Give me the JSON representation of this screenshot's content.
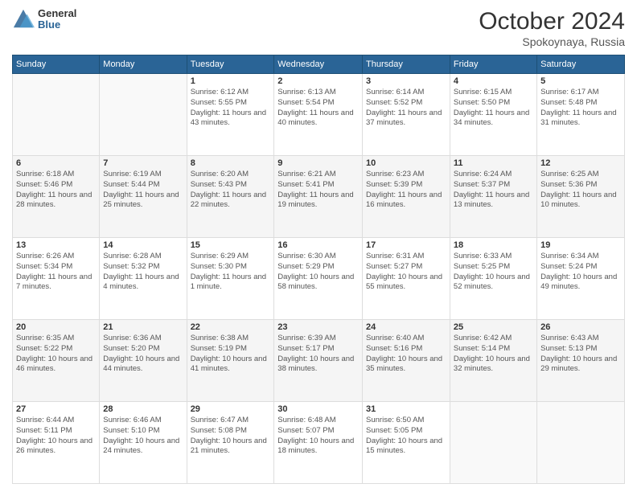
{
  "header": {
    "logo_general": "General",
    "logo_blue": "Blue",
    "month_title": "October 2024",
    "location": "Spokoynaya, Russia"
  },
  "days_of_week": [
    "Sunday",
    "Monday",
    "Tuesday",
    "Wednesday",
    "Thursday",
    "Friday",
    "Saturday"
  ],
  "weeks": [
    [
      {
        "day": "",
        "info": ""
      },
      {
        "day": "",
        "info": ""
      },
      {
        "day": "1",
        "info": "Sunrise: 6:12 AM\nSunset: 5:55 PM\nDaylight: 11 hours and 43 minutes."
      },
      {
        "day": "2",
        "info": "Sunrise: 6:13 AM\nSunset: 5:54 PM\nDaylight: 11 hours and 40 minutes."
      },
      {
        "day": "3",
        "info": "Sunrise: 6:14 AM\nSunset: 5:52 PM\nDaylight: 11 hours and 37 minutes."
      },
      {
        "day": "4",
        "info": "Sunrise: 6:15 AM\nSunset: 5:50 PM\nDaylight: 11 hours and 34 minutes."
      },
      {
        "day": "5",
        "info": "Sunrise: 6:17 AM\nSunset: 5:48 PM\nDaylight: 11 hours and 31 minutes."
      }
    ],
    [
      {
        "day": "6",
        "info": "Sunrise: 6:18 AM\nSunset: 5:46 PM\nDaylight: 11 hours and 28 minutes."
      },
      {
        "day": "7",
        "info": "Sunrise: 6:19 AM\nSunset: 5:44 PM\nDaylight: 11 hours and 25 minutes."
      },
      {
        "day": "8",
        "info": "Sunrise: 6:20 AM\nSunset: 5:43 PM\nDaylight: 11 hours and 22 minutes."
      },
      {
        "day": "9",
        "info": "Sunrise: 6:21 AM\nSunset: 5:41 PM\nDaylight: 11 hours and 19 minutes."
      },
      {
        "day": "10",
        "info": "Sunrise: 6:23 AM\nSunset: 5:39 PM\nDaylight: 11 hours and 16 minutes."
      },
      {
        "day": "11",
        "info": "Sunrise: 6:24 AM\nSunset: 5:37 PM\nDaylight: 11 hours and 13 minutes."
      },
      {
        "day": "12",
        "info": "Sunrise: 6:25 AM\nSunset: 5:36 PM\nDaylight: 11 hours and 10 minutes."
      }
    ],
    [
      {
        "day": "13",
        "info": "Sunrise: 6:26 AM\nSunset: 5:34 PM\nDaylight: 11 hours and 7 minutes."
      },
      {
        "day": "14",
        "info": "Sunrise: 6:28 AM\nSunset: 5:32 PM\nDaylight: 11 hours and 4 minutes."
      },
      {
        "day": "15",
        "info": "Sunrise: 6:29 AM\nSunset: 5:30 PM\nDaylight: 11 hours and 1 minute."
      },
      {
        "day": "16",
        "info": "Sunrise: 6:30 AM\nSunset: 5:29 PM\nDaylight: 10 hours and 58 minutes."
      },
      {
        "day": "17",
        "info": "Sunrise: 6:31 AM\nSunset: 5:27 PM\nDaylight: 10 hours and 55 minutes."
      },
      {
        "day": "18",
        "info": "Sunrise: 6:33 AM\nSunset: 5:25 PM\nDaylight: 10 hours and 52 minutes."
      },
      {
        "day": "19",
        "info": "Sunrise: 6:34 AM\nSunset: 5:24 PM\nDaylight: 10 hours and 49 minutes."
      }
    ],
    [
      {
        "day": "20",
        "info": "Sunrise: 6:35 AM\nSunset: 5:22 PM\nDaylight: 10 hours and 46 minutes."
      },
      {
        "day": "21",
        "info": "Sunrise: 6:36 AM\nSunset: 5:20 PM\nDaylight: 10 hours and 44 minutes."
      },
      {
        "day": "22",
        "info": "Sunrise: 6:38 AM\nSunset: 5:19 PM\nDaylight: 10 hours and 41 minutes."
      },
      {
        "day": "23",
        "info": "Sunrise: 6:39 AM\nSunset: 5:17 PM\nDaylight: 10 hours and 38 minutes."
      },
      {
        "day": "24",
        "info": "Sunrise: 6:40 AM\nSunset: 5:16 PM\nDaylight: 10 hours and 35 minutes."
      },
      {
        "day": "25",
        "info": "Sunrise: 6:42 AM\nSunset: 5:14 PM\nDaylight: 10 hours and 32 minutes."
      },
      {
        "day": "26",
        "info": "Sunrise: 6:43 AM\nSunset: 5:13 PM\nDaylight: 10 hours and 29 minutes."
      }
    ],
    [
      {
        "day": "27",
        "info": "Sunrise: 6:44 AM\nSunset: 5:11 PM\nDaylight: 10 hours and 26 minutes."
      },
      {
        "day": "28",
        "info": "Sunrise: 6:46 AM\nSunset: 5:10 PM\nDaylight: 10 hours and 24 minutes."
      },
      {
        "day": "29",
        "info": "Sunrise: 6:47 AM\nSunset: 5:08 PM\nDaylight: 10 hours and 21 minutes."
      },
      {
        "day": "30",
        "info": "Sunrise: 6:48 AM\nSunset: 5:07 PM\nDaylight: 10 hours and 18 minutes."
      },
      {
        "day": "31",
        "info": "Sunrise: 6:50 AM\nSunset: 5:05 PM\nDaylight: 10 hours and 15 minutes."
      },
      {
        "day": "",
        "info": ""
      },
      {
        "day": "",
        "info": ""
      }
    ]
  ]
}
